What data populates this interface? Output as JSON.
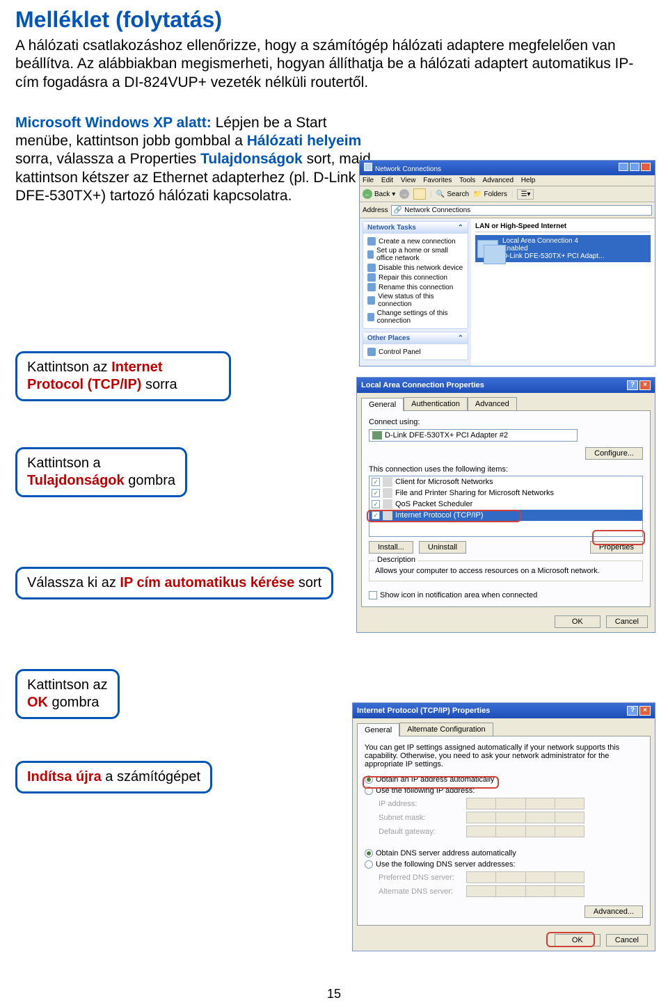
{
  "doc": {
    "title": "Melléklet (folytatás)",
    "intro": "A hálózati csatlakozáshoz ellenőrizze, hogy a számítógép hálózati adaptere megfelelően van beállítva. Az alábbiakban megismerheti, hogyan állíthatja be a hálózati adaptert automatikus IP-cím fogadásra a DI-824VUP+ vezeték nélküli routertől.",
    "para2_lead": "Microsoft Windows XP alatt:",
    "para2_body1": " Lépjen be a Start menübe, kattintson jobb gombbal a ",
    "para2_net": "Hálózati helyeim",
    "para2_body2": " sorra, válassza a Properties ",
    "para2_props": "Tulajdonságok",
    "para2_body3": " sort, majd kattintson kétszer az Ethernet adapterhez (pl. D-Link DFE-530TX+) tartozó hálózati kapcsolatra.",
    "pageNum": "15"
  },
  "callouts": {
    "c1a": "Kattintson az ",
    "c1b": "Internet Protocol (TCP/IP)",
    "c1c": " sorra",
    "c2a": "Kattintson a ",
    "c2b": "Tulajdonságok",
    "c2c": " gombra",
    "c3a": "Válassza ki az ",
    "c3b": "IP cím automatikus kérése",
    "c3c": " sort",
    "c4a": "Kattintson az ",
    "c4b": "OK",
    "c4c": " gombra",
    "c5a": "Indítsa újra",
    "c5b": " a számítógépet"
  },
  "shot1": {
    "title": "Network Connections",
    "menu": {
      "file": "File",
      "edit": "Edit",
      "view": "View",
      "fav": "Favorites",
      "tools": "Tools",
      "adv": "Advanced",
      "help": "Help"
    },
    "toolbar": {
      "back": "Back",
      "search": "Search",
      "folders": "Folders"
    },
    "address_lbl": "Address",
    "address_val": "Network Connections",
    "side": {
      "tasks_hdr": "Network Tasks",
      "t1": "Create a new connection",
      "t2": "Set up a home or small office network",
      "t3": "Disable this network device",
      "t4": "Repair this connection",
      "t5": "Rename this connection",
      "t6": "View status of this connection",
      "t7": "Change settings of this connection",
      "other_hdr": "Other Places",
      "o1": "Control Panel"
    },
    "cat": "LAN or High-Speed Internet",
    "conn_name": "Local Area Connection 4",
    "conn_state": "Enabled",
    "conn_dev": "D-Link DFE-530TX+ PCI Adapt..."
  },
  "shot2": {
    "title": "Local Area Connection Properties",
    "tabs": {
      "general": "General",
      "auth": "Authentication",
      "adv": "Advanced"
    },
    "connect_using": "Connect using:",
    "adapter": "D-Link DFE-530TX+ PCI Adapter #2",
    "configure": "Configure...",
    "uses": "This connection uses the following items:",
    "items": {
      "i1": "Client for Microsoft Networks",
      "i2": "File and Printer Sharing for Microsoft Networks",
      "i3": "QoS Packet Scheduler",
      "i4": "Internet Protocol (TCP/IP)"
    },
    "install": "Install...",
    "uninstall": "Uninstall",
    "properties": "Properties",
    "desc_hdr": "Description",
    "desc_body": "Allows your computer to access resources on a Microsoft network.",
    "show_icon": "Show icon in notification area when connected",
    "ok": "OK",
    "cancel": "Cancel"
  },
  "shot3": {
    "title": "Internet Protocol (TCP/IP) Properties",
    "tabs": {
      "general": "General",
      "alt": "Alternate Configuration"
    },
    "blurb": "You can get IP settings assigned automatically if your network supports this capability. Otherwise, you need to ask your network administrator for the appropriate IP settings.",
    "r1": "Obtain an IP address automatically",
    "r2": "Use the following IP address:",
    "ip": "IP address:",
    "subnet": "Subnet mask:",
    "gw": "Default gateway:",
    "r3": "Obtain DNS server address automatically",
    "r4": "Use the following DNS server addresses:",
    "pdns": "Preferred DNS server:",
    "adns": "Alternate DNS server:",
    "advanced": "Advanced...",
    "ok": "OK",
    "cancel": "Cancel"
  }
}
